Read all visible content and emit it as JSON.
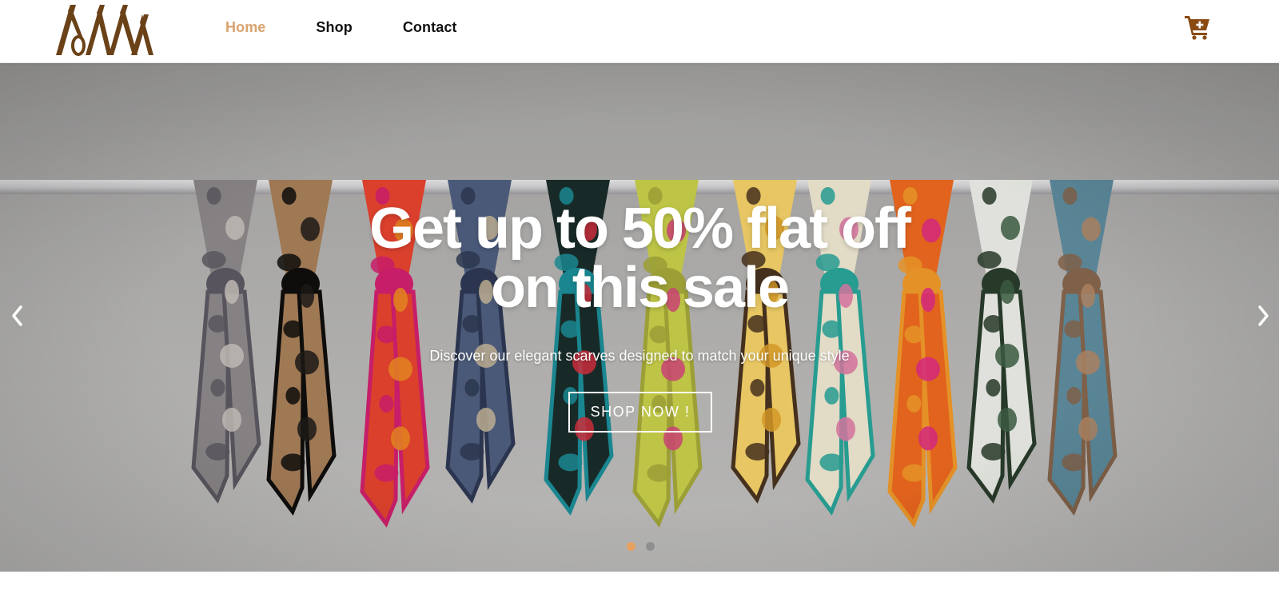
{
  "brand": {
    "logo_text": "AMA",
    "color": "#6b4218"
  },
  "nav": {
    "items": [
      {
        "label": "Home",
        "active": true
      },
      {
        "label": "Shop",
        "active": false
      },
      {
        "label": "Contact",
        "active": false
      }
    ],
    "active_color": "#d9a36f"
  },
  "cart": {
    "icon": "cart-plus-icon",
    "color": "#8a4b12"
  },
  "hero": {
    "title_line1": "Get up to 50% flat off",
    "title_line2": "on this sale",
    "subtitle": "Discover our elegant scarves designed to match your unique style",
    "cta_label": "SHOP NOW !",
    "prev_icon": "chevron-left-icon",
    "next_icon": "chevron-right-icon",
    "slides": {
      "count": 2,
      "active_index": 0
    }
  }
}
